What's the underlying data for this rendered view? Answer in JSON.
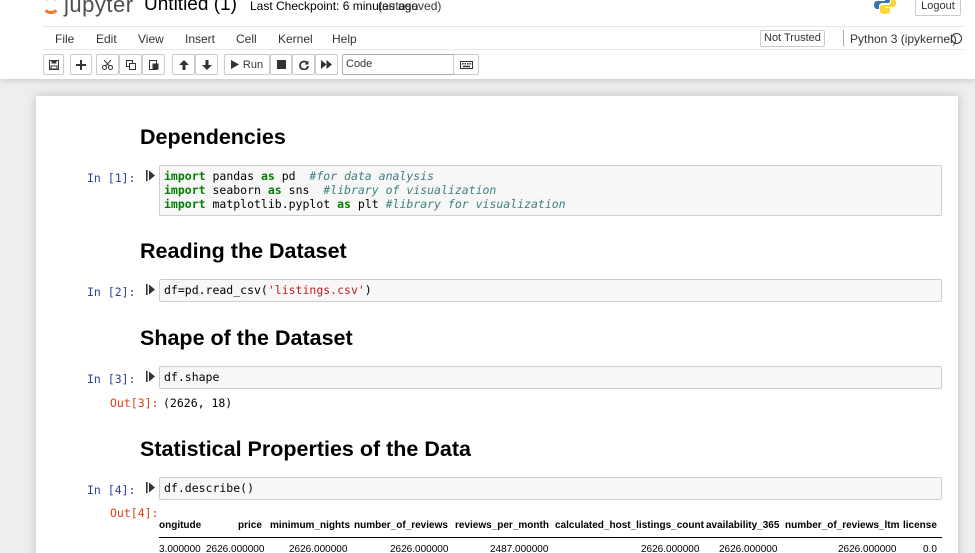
{
  "app": {
    "logo_text": "jupyter",
    "notebook_title": "Untitled (1)",
    "checkpoint": "Last Checkpoint: 6 minutes ago",
    "autosave": "(autosaved)",
    "logout_label": "Logout"
  },
  "menu": {
    "items": [
      "File",
      "Edit",
      "View",
      "Insert",
      "Cell",
      "Kernel",
      "Help"
    ],
    "trust_label": "Not Trusted",
    "kernel_name": "Python 3 (ipykernel)"
  },
  "toolbar": {
    "run_label": "Run",
    "cell_type": "Code",
    "icons": [
      "save-icon",
      "add-cell-icon",
      "cut-icon",
      "copy-icon",
      "paste-icon",
      "move-up-icon",
      "move-down-icon",
      "run-icon",
      "stop-icon",
      "restart-icon",
      "fast-forward-icon",
      "keyboard-icon"
    ]
  },
  "cells": {
    "h1": "Dependencies",
    "c1_prompt": "In [1]:",
    "c1_lines": [
      {
        "kw1": "import",
        "mod": " pandas ",
        "kw2": "as",
        "alias": " pd  ",
        "comment": "#for data analysis"
      },
      {
        "kw1": "import",
        "mod": " seaborn ",
        "kw2": "as",
        "alias": " sns  ",
        "comment": "#library of visualization"
      },
      {
        "kw1": "import",
        "mod": " matplotlib.pyplot ",
        "kw2": "as",
        "alias": " plt ",
        "comment": "#library for visualization"
      }
    ],
    "h2": "Reading the Dataset",
    "c2_prompt": "In [2]:",
    "c2_code_pre": "df=pd.read_csv(",
    "c2_code_str": "'listings.csv'",
    "c2_code_post": ")",
    "h3": "Shape of the Dataset",
    "c3_prompt": "In [3]:",
    "c3_code": "df.shape",
    "c3_out_prompt": "Out[3]:",
    "c3_output": "(2626, 18)",
    "h4": "Statistical Properties of the Data",
    "c4_prompt": "In [4]:",
    "c4_code": "df.describe()",
    "c4_out_prompt": "Out[4]:"
  },
  "describe_table": {
    "columns": [
      "ongitude",
      "price",
      "minimum_nights",
      "number_of_reviews",
      "reviews_per_month",
      "calculated_host_listings_count",
      "availability_365",
      "number_of_reviews_ltm",
      "license"
    ],
    "first_row": [
      "3.000000",
      "2626.000000",
      "2626.000000",
      "2626.000000",
      "2487.000000",
      "2626.000000",
      "2626.000000",
      "2626.000000",
      "0.0"
    ]
  }
}
